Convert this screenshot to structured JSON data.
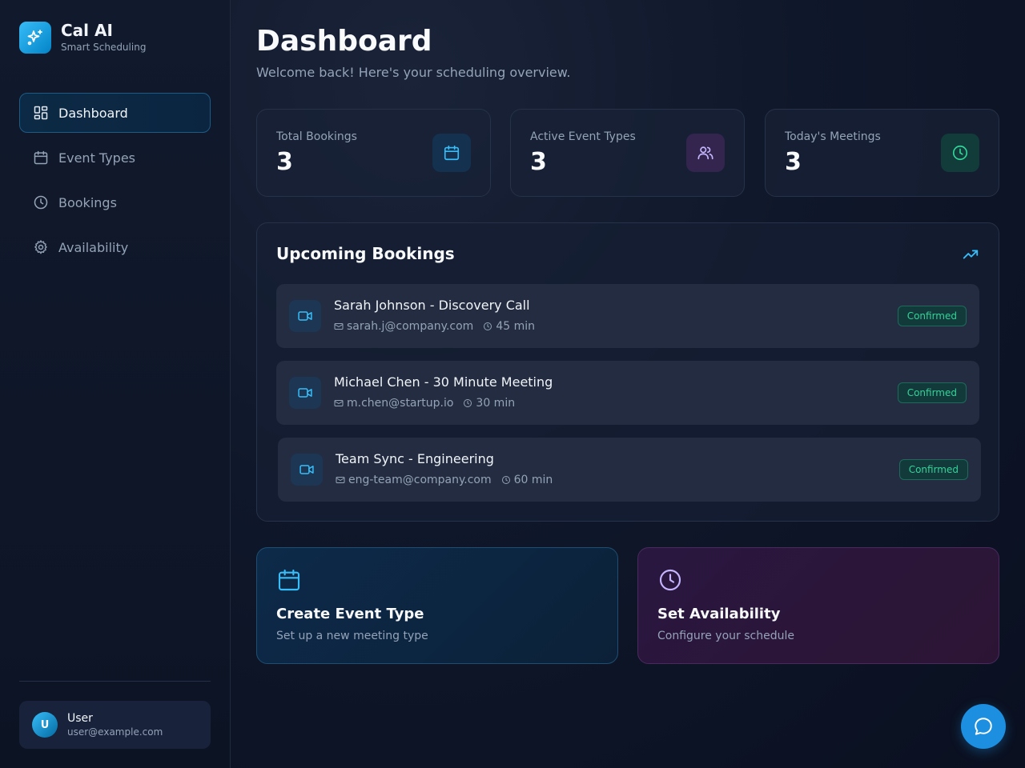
{
  "brand": {
    "name": "Cal AI",
    "subtitle": "Smart Scheduling",
    "icon": "sparkles-icon"
  },
  "nav": {
    "items": [
      {
        "label": "Dashboard",
        "icon": "dashboard-grid-icon",
        "active": true
      },
      {
        "label": "Event Types",
        "icon": "calendar-icon",
        "active": false
      },
      {
        "label": "Bookings",
        "icon": "clock-icon",
        "active": false
      },
      {
        "label": "Availability",
        "icon": "gear-icon",
        "active": false
      }
    ]
  },
  "user": {
    "initial": "U",
    "name": "User",
    "email": "user@example.com"
  },
  "page": {
    "title": "Dashboard",
    "subtitle": "Welcome back! Here's your scheduling overview."
  },
  "stats": [
    {
      "label": "Total Bookings",
      "value": "3",
      "icon": "calendar-icon",
      "color": "#38bdf8"
    },
    {
      "label": "Active Event Types",
      "value": "3",
      "icon": "users-icon",
      "color": "#c4b5fd"
    },
    {
      "label": "Today's Meetings",
      "value": "3",
      "icon": "clock-icon",
      "color": "#34d399"
    }
  ],
  "bookings": {
    "title": "Upcoming Bookings",
    "icon": "trending-up-icon",
    "items": [
      {
        "title": "Sarah Johnson - Discovery Call",
        "email": "sarah.j@company.com",
        "duration": "45 min",
        "status": "Confirmed"
      },
      {
        "title": "Michael Chen - 30 Minute Meeting",
        "email": "m.chen@startup.io",
        "duration": "30 min",
        "status": "Confirmed"
      },
      {
        "title": "Team Sync - Engineering",
        "email": "eng-team@company.com",
        "duration": "60 min",
        "status": "Confirmed"
      }
    ]
  },
  "actions": {
    "create": {
      "title": "Create Event Type",
      "subtitle": "Set up a new meeting type",
      "icon": "calendar-icon"
    },
    "availability": {
      "title": "Set Availability",
      "subtitle": "Configure your schedule",
      "icon": "clock-icon"
    }
  },
  "chat": {
    "icon": "chat-bubble-icon"
  },
  "colors": {
    "accent": "#38bdf8",
    "success": "#34d399",
    "purple": "#c4b5fd",
    "fab": "#1d8fe0"
  }
}
